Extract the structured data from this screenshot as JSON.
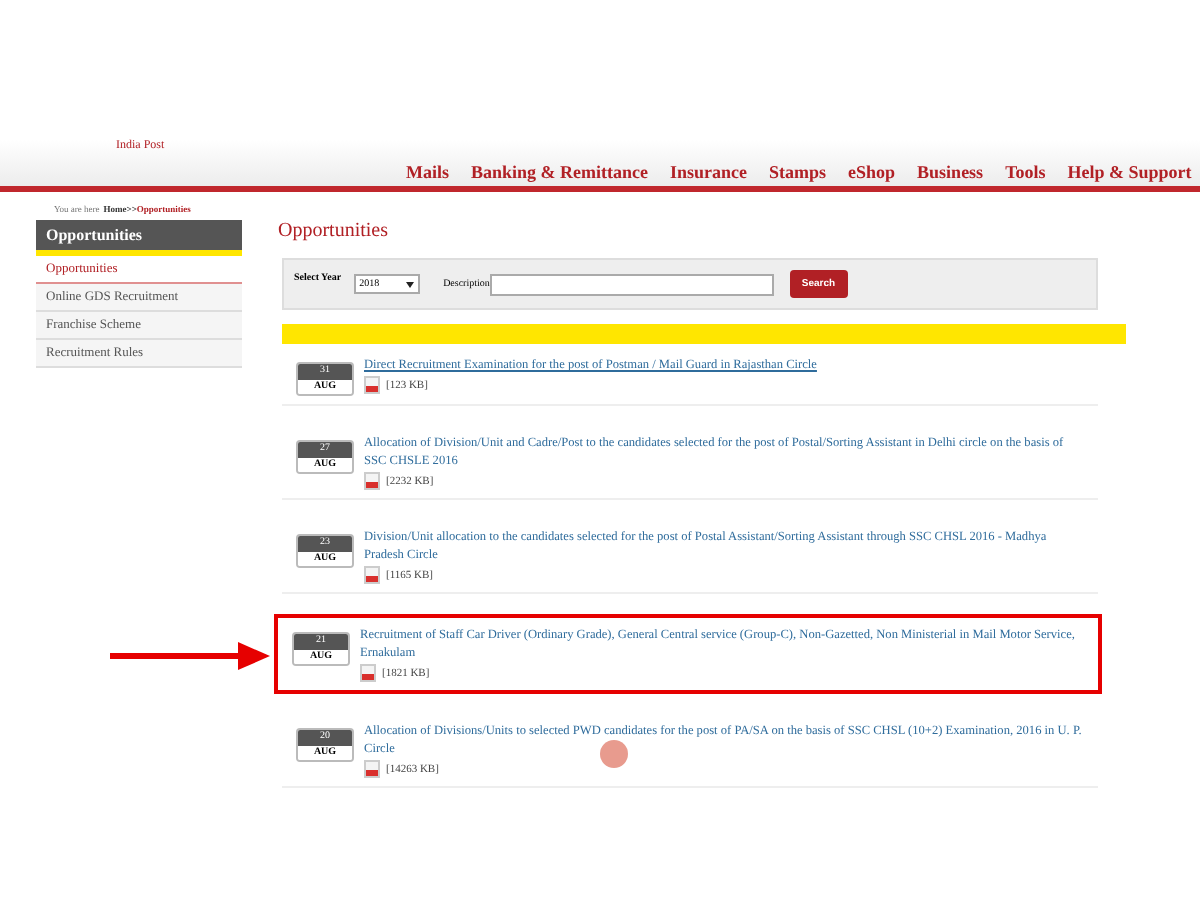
{
  "header": {
    "logo": "India Post",
    "nav": [
      "Mails",
      "Banking & Remittance",
      "Insurance",
      "Stamps",
      "eShop",
      "Business",
      "Tools",
      "Help & Support"
    ]
  },
  "breadcrumb": {
    "prefix": "You are here",
    "home": "Home>>",
    "current": "Opportunities"
  },
  "sidebar": {
    "title": "Opportunities",
    "items": [
      {
        "label": "Opportunities",
        "selected": true
      },
      {
        "label": "Online GDS Recruitment",
        "selected": false
      },
      {
        "label": "Franchise Scheme",
        "selected": false
      },
      {
        "label": "Recruitment Rules",
        "selected": false
      }
    ]
  },
  "main": {
    "title": "Opportunities",
    "filter": {
      "year_label": "Select Year",
      "year": "2018",
      "description_label": "Description",
      "search_button": "Search"
    },
    "items": [
      {
        "day": "31",
        "month": "AUG",
        "title": "Direct Recruitment Examination for the post of Postman / Mail Guard in Rajasthan Circle",
        "size": "[123 KB]",
        "underlined": true,
        "highlighted": false
      },
      {
        "day": "27",
        "month": "AUG",
        "title": "Allocation of Division/Unit and Cadre/Post to the candidates selected for the post of Postal/Sorting Assistant in Delhi circle on the basis of SSC CHSLE 2016",
        "size": "[2232 KB]",
        "underlined": false,
        "highlighted": false
      },
      {
        "day": "23",
        "month": "AUG",
        "title": "Division/Unit allocation to the candidates selected for the post of Postal Assistant/Sorting Assistant through SSC CHSL 2016 - Madhya Pradesh Circle",
        "size": "[1165 KB]",
        "underlined": false,
        "highlighted": false
      },
      {
        "day": "21",
        "month": "AUG",
        "title": "Recruitment of Staff Car Driver (Ordinary Grade), General Central service (Group-C), Non-Gazetted, Non Ministerial in Mail Motor Service, Ernakulam",
        "size": "[1821 KB]",
        "underlined": false,
        "highlighted": true
      },
      {
        "day": "20",
        "month": "AUG",
        "title": "Allocation of Divisions/Units to selected PWD candidates for the post of PA/SA on the basis of SSC CHSL (10+2) Examination, 2016 in U. P. Circle",
        "size": "[14263 KB]",
        "underlined": false,
        "highlighted": false
      }
    ]
  }
}
